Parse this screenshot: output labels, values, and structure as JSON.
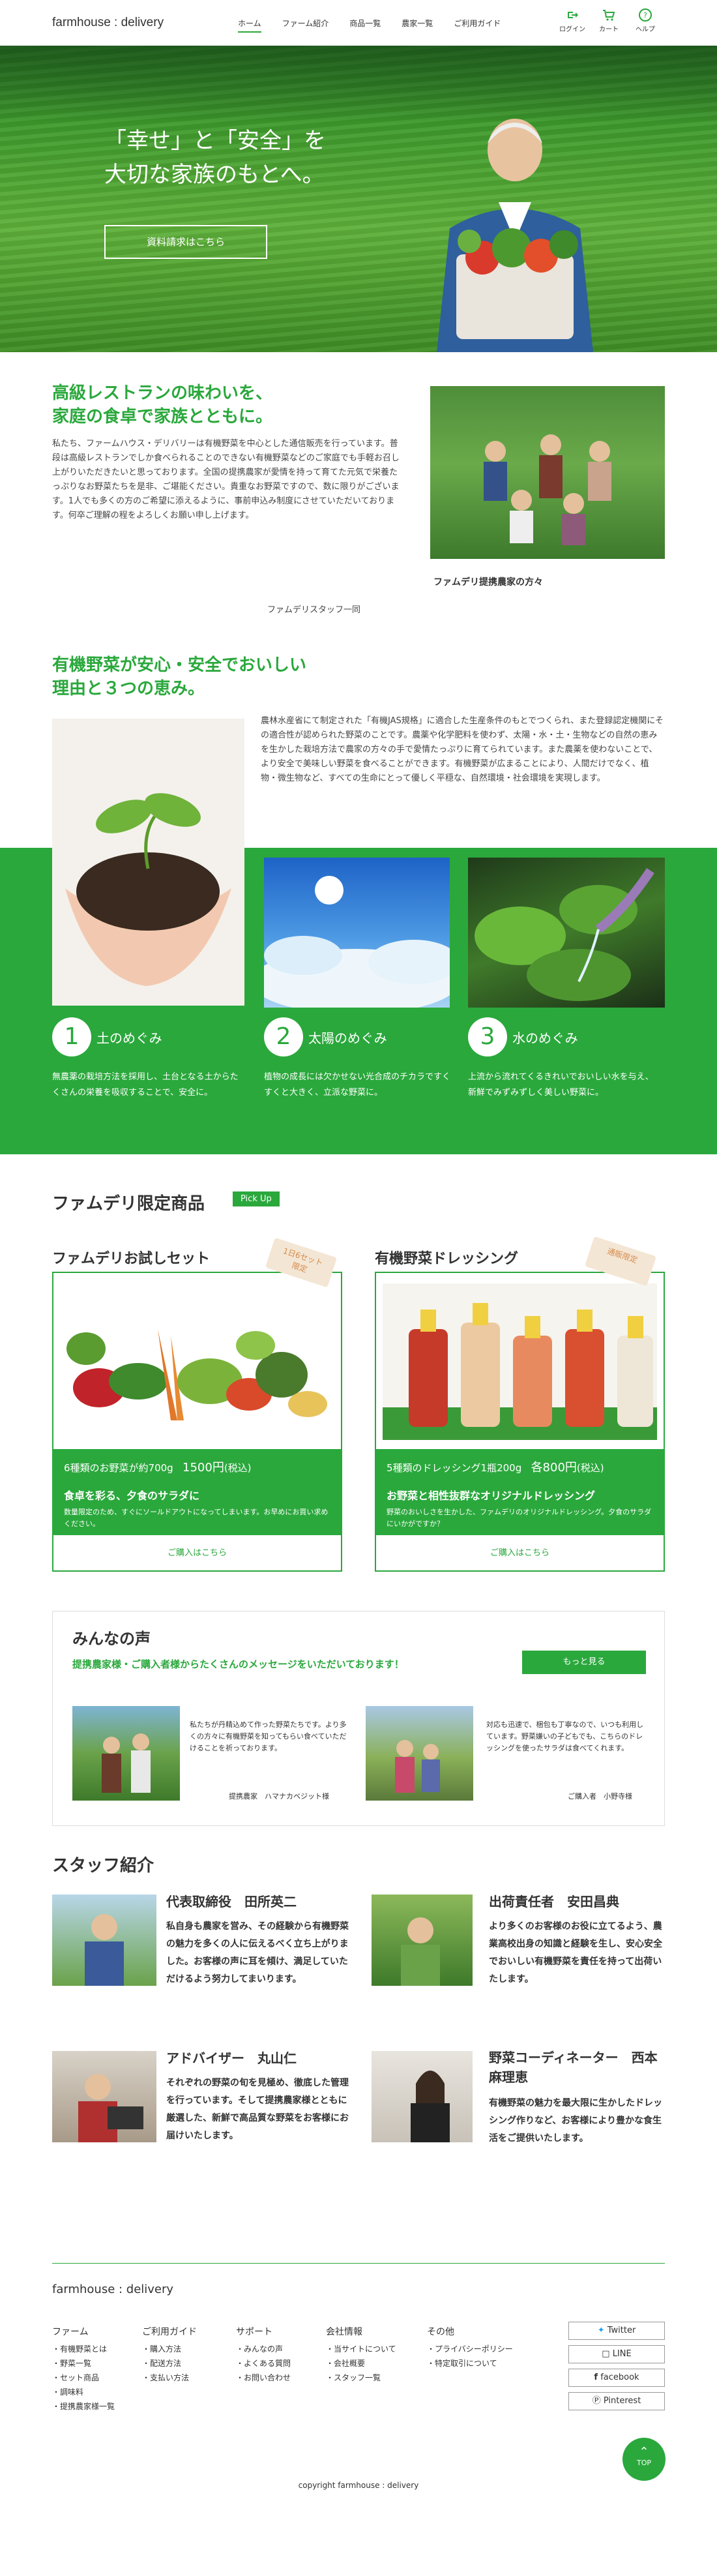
{
  "header": {
    "logo": "farmhouse : delivery",
    "nav": [
      "ホーム",
      "ファーム紹介",
      "商品一覧",
      "農家一覧",
      "ご利用ガイド"
    ],
    "icons": [
      {
        "label": "ログイン",
        "icon": "login-icon"
      },
      {
        "label": "カート",
        "icon": "cart-icon"
      },
      {
        "label": "ヘルプ",
        "icon": "help-icon"
      }
    ]
  },
  "hero": {
    "line1": "「幸せ」と「安全」を",
    "line2": "大切な家族のもとへ。",
    "button": "資料請求はこちら"
  },
  "intro": {
    "title1": "高級レストランの味わいを、",
    "title2": "家庭の食卓で家族とともに。",
    "body": "私たち、ファームハウス・デリバリーは有機野菜を中心とした通信販売を行っています。普段は高級レストランでしか食べられることのできない有機野菜などのご家庭でも手軽お召し上がりいただきたいと思っております。全国の提携農家が愛情を持って育てた元気で栄養たっぷりなお野菜たちを是非、ご堪能ください。貴重なお野菜ですので、数に限りがございます。1人でも多くの方のご希望に添えるように、事前申込み制度にさせていただいております。何卒ご理解の程をよろしくお願い申し上げます。",
    "signature": "ファムデリスタッフ一同",
    "photo_caption": "ファムデリ提携農家の方々"
  },
  "organic": {
    "title1": "有機野菜が安心・安全でおいしい",
    "title2": "理由と３つの恵み。",
    "body": "農林水産省にて制定された「有機JAS規格」に適合した生産条件のもとでつくられ、また登録認定機関にその適合性が認められた野菜のことです。農薬や化学肥料を使わず、太陽・水・土・生物などの自然の恵みを生かした栽培方法で農家の方々の手で愛情たっぷりに育てられています。また農薬を使わないことで、より安全で美味しい野菜を食べることができます。有機野菜が広まることにより、人間だけでなく、植物・微生物など、すべての生命にとって優しく平穏な、自然環境・社会環境を実現します。",
    "features": [
      {
        "num": "1",
        "title": "土のめぐみ",
        "text": "無農薬の栽培方法を採用し、土台となる土からたくさんの栄養を吸収することで、安全に。"
      },
      {
        "num": "2",
        "title": "太陽のめぐみ",
        "text": "植物の成長には欠かせない光合成のチカラですくすくと大きく、立派な野菜に。"
      },
      {
        "num": "3",
        "title": "水のめぐみ",
        "text": "上流から流れてくるきれいでおいしい水を与え、新鮮でみずみずしく美しい野菜に。"
      }
    ]
  },
  "products": {
    "heading": "ファムデリ限定商品",
    "badge": "Pick Up",
    "items": [
      {
        "title": "ファムデリお試しセット",
        "tag1": "1日6セット",
        "tag2": "限定",
        "price_line_a": "6種類のお野菜が約700g",
        "price_num": "1500円",
        "price_tax": "(税込)",
        "sub": "食卓を彩る、夕食のサラダに",
        "note": "数量限定のため、すぐにソールドアウトになってしまいます。お早めにお買い求めください。",
        "buy": "ご購入はこちら"
      },
      {
        "title": "有機野菜ドレッシング",
        "tag1": "通販限定",
        "tag2": "",
        "price_line_a": "5種類のドレッシング1瓶200g",
        "price_num": "各800円",
        "price_tax": "(税込)",
        "sub": "お野菜と相性抜群なオリジナルドレッシング",
        "note": "野菜のおいしさを生かした、ファムデリのオリジナルドレッシング。夕食のサラダにいかがですか？",
        "buy": "ご購入はこちら"
      }
    ]
  },
  "voices": {
    "heading": "みんなの声",
    "lead": "提携農家様・ご購入者様からたくさんのメッセージをいただいております！",
    "more": "もっと見る",
    "items": [
      {
        "text": "私たちが丹精込めて作った野菜たちです。より多くの方々に有機野菜を知ってもらい食べていただけることを祈っております。",
        "who": "提携農家　ハマナカベジット様"
      },
      {
        "text": "対応も迅速で、梱包も丁寧なので、いつも利用しています。野菜嫌いの子どもでも、こちらのドレッシングを使ったサラダは食べてくれます。",
        "who": "ご購入者　小野寺様"
      }
    ]
  },
  "staff": {
    "heading": "スタッフ紹介",
    "members": [
      {
        "name": "代表取締役　田所英二",
        "text": "私自身も農家を営み、その経験から有機野菜の魅力を多くの人に伝えるべく立ち上がりました。お客様の声に耳を傾け、満足していただけるよう努力してまいります。"
      },
      {
        "name": "出荷責任者　安田昌典",
        "text": "より多くのお客様のお役に立てるよう、農業高校出身の知識と経験を生し、安心安全でおいしい有機野菜を責任を持って出荷いたします。"
      },
      {
        "name": "アドバイザー　丸山仁",
        "text": "それぞれの野菜の旬を見極め、徹底した管理を行っています。そして提携農家様とともに厳選した、新鮮で高品質な野菜をお客様にお届けいたします。"
      },
      {
        "name": "野菜コーディネーター　西本麻理恵",
        "text": "有機野菜の魅力を最大限に生かしたドレッシング作りなど、お客様により豊かな食生活をご提供いたします。"
      }
    ]
  },
  "footer": {
    "logo": "farmhouse : delivery",
    "cols": [
      {
        "title": "ファーム",
        "items": [
          "・有機野菜とは",
          "・野菜一覧",
          "・セット商品",
          "・調味料",
          "・提携農家様一覧"
        ]
      },
      {
        "title": "ご利用ガイド",
        "items": [
          "・購入方法",
          "・配送方法",
          "・支払い方法"
        ]
      },
      {
        "title": "サポート",
        "items": [
          "・みんなの声",
          "・よくある質問",
          "・お問い合わせ"
        ]
      },
      {
        "title": "会社情報",
        "items": [
          "・当サイトについて",
          "・会社概要",
          "・スタッフ一覧"
        ]
      },
      {
        "title": "その他",
        "items": [
          "・プライバシーポリシー",
          "・特定取引について"
        ]
      }
    ],
    "sns": [
      "Twitter",
      "LINE",
      "facebook",
      "Pinterest"
    ],
    "totop": "TOP",
    "copyright": "copyright farmhouse : delivery"
  },
  "colors": {
    "accent": "#2aa83c"
  }
}
